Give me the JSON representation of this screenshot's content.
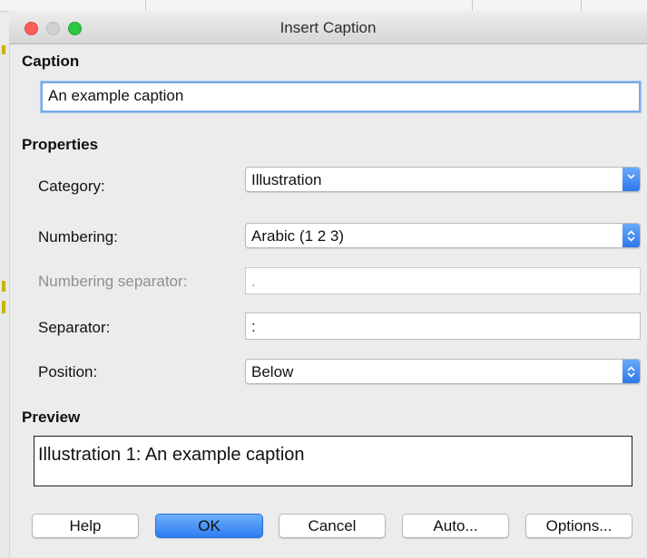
{
  "window": {
    "title": "Insert Caption"
  },
  "caption": {
    "heading": "Caption",
    "value": "An example caption"
  },
  "properties": {
    "heading": "Properties",
    "category": {
      "label": "Category:",
      "value": "Illustration"
    },
    "numbering": {
      "label": "Numbering:",
      "value": "Arabic (1 2 3)"
    },
    "numbering_separator": {
      "label": "Numbering separator:",
      "value": "."
    },
    "separator": {
      "label": "Separator:",
      "value": ":"
    },
    "position": {
      "label": "Position:",
      "value": "Below"
    }
  },
  "preview": {
    "heading": "Preview",
    "text": "Illustration 1: An example caption"
  },
  "buttons": {
    "help": "Help",
    "ok": "OK",
    "cancel": "Cancel",
    "auto": "Auto...",
    "options": "Options..."
  },
  "colors": {
    "accent": "#2e7cf2",
    "close": "#fc5f57",
    "maximize": "#2bc840"
  }
}
